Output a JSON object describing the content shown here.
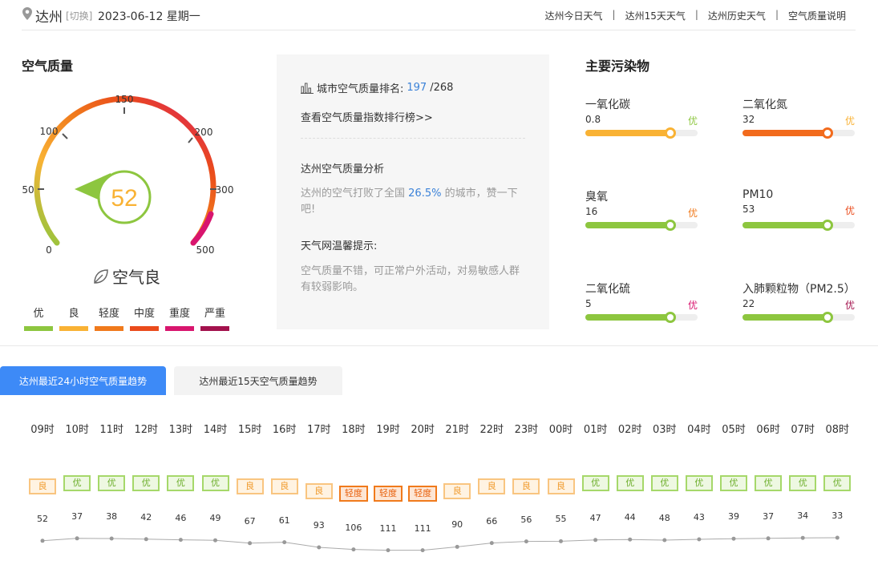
{
  "header": {
    "city": "达州",
    "switch_label": "[切换]",
    "date": "2023-06-12 星期一",
    "links": [
      "达州今日天气",
      "达州15天天气",
      "达州历史天气",
      "空气质量说明"
    ],
    "separator": "|"
  },
  "aqi": {
    "title": "空气质量",
    "value": "52",
    "word": "空气良",
    "scale_labels": [
      "0",
      "50",
      "100",
      "150",
      "200",
      "300",
      "500"
    ],
    "legend": [
      {
        "label": "优",
        "color": "#8dc63f"
      },
      {
        "label": "良",
        "color": "#f9b234"
      },
      {
        "label": "轻度",
        "color": "#f07a1c"
      },
      {
        "label": "中度",
        "color": "#ea4b1c"
      },
      {
        "label": "重度",
        "color": "#d8156e"
      },
      {
        "label": "严重",
        "color": "#a3124d"
      }
    ]
  },
  "ranking": {
    "label": "城市空气质量排名:",
    "rank": "197",
    "total": "/268",
    "link": "查看空气质量指数排行榜>>",
    "analysis_title": "达州空气质量分析",
    "analysis_pre": "达州的空气打败了全国",
    "analysis_pct": "26.5%",
    "analysis_post": "的城市，赞一下吧!",
    "tip_title": "天气网温馨提示:",
    "tip_text": "空气质量不错，可正常户外活动，对易敏感人群有较弱影响。"
  },
  "pollutants": {
    "title": "主要污染物",
    "items": [
      {
        "name": "一氧化碳",
        "value": "0.8",
        "level": "优",
        "level_color": "#8dc63f",
        "bar_color": "#f9b234",
        "fill_pct": 76
      },
      {
        "name": "二氧化氮",
        "value": "32",
        "level": "优",
        "level_color": "#f9b234",
        "bar_color": "#f26b1d",
        "fill_pct": 76
      },
      {
        "name": "臭氧",
        "value": "16",
        "level": "优",
        "level_color": "#f07a1c",
        "bar_color": "#8dc63f",
        "fill_pct": 76
      },
      {
        "name": "PM10",
        "value": "53",
        "level": "优",
        "level_color": "#ea4b1c",
        "bar_color": "#8dc63f",
        "fill_pct": 76
      },
      {
        "name": "二氧化硫",
        "value": "5",
        "level": "优",
        "level_color": "#d8156e",
        "bar_color": "#8dc63f",
        "fill_pct": 76
      },
      {
        "name": "入肺颗粒物（PM2.5）",
        "value": "22",
        "level": "优",
        "level_color": "#a3124d",
        "bar_color": "#8dc63f",
        "fill_pct": 76
      }
    ]
  },
  "tabs": [
    "达州最近24小时空气质量趋势",
    "达州最近15天空气质量趋势"
  ],
  "hourly": [
    {
      "time": "09时",
      "level": "良",
      "value": 52
    },
    {
      "time": "10时",
      "level": "优",
      "value": 37
    },
    {
      "time": "11时",
      "level": "优",
      "value": 38
    },
    {
      "time": "12时",
      "level": "优",
      "value": 42
    },
    {
      "time": "13时",
      "level": "优",
      "value": 46
    },
    {
      "time": "14时",
      "level": "优",
      "value": 49
    },
    {
      "time": "15时",
      "level": "良",
      "value": 67
    },
    {
      "time": "16时",
      "level": "良",
      "value": 61
    },
    {
      "time": "17时",
      "level": "良",
      "value": 93
    },
    {
      "time": "18时",
      "level": "轻度",
      "value": 106
    },
    {
      "time": "19时",
      "level": "轻度",
      "value": 111
    },
    {
      "time": "20时",
      "level": "轻度",
      "value": 111
    },
    {
      "time": "21时",
      "level": "良",
      "value": 90
    },
    {
      "time": "22时",
      "level": "良",
      "value": 66
    },
    {
      "time": "23时",
      "level": "良",
      "value": 56
    },
    {
      "time": "00时",
      "level": "良",
      "value": 55
    },
    {
      "time": "01时",
      "level": "优",
      "value": 47
    },
    {
      "time": "02时",
      "level": "优",
      "value": 44
    },
    {
      "time": "03时",
      "level": "优",
      "value": 48
    },
    {
      "time": "04时",
      "level": "优",
      "value": 43
    },
    {
      "time": "05时",
      "level": "优",
      "value": 39
    },
    {
      "time": "06时",
      "level": "优",
      "value": 37
    },
    {
      "time": "07时",
      "level": "优",
      "value": 34
    },
    {
      "time": "08时",
      "level": "优",
      "value": 33
    }
  ],
  "level_styles": {
    "优": {
      "border": "#a6d86a",
      "bg": "#eef8e2",
      "color": "#6cae2a"
    },
    "良": {
      "border": "#f9c580",
      "bg": "#fff3e2",
      "color": "#f09a2b"
    },
    "轻度": {
      "border": "#f07a1c",
      "bg": "#fde6d5",
      "color": "#e8600c"
    }
  }
}
